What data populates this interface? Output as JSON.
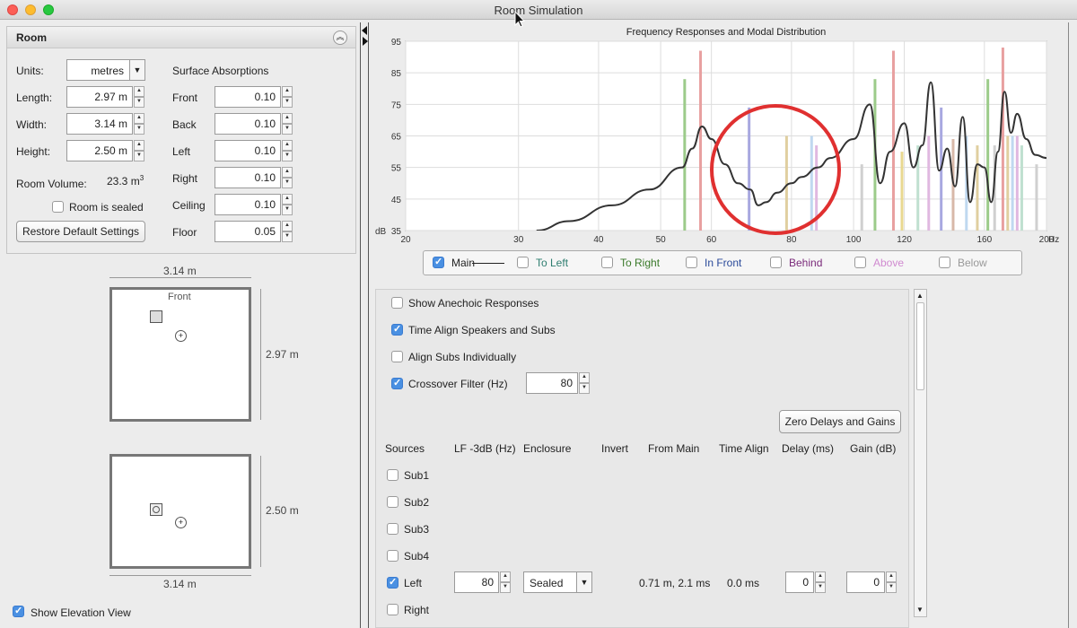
{
  "window": {
    "title": "Room Simulation"
  },
  "room": {
    "panel_title": "Room",
    "units_label": "Units:",
    "units_value": "metres",
    "length_label": "Length:",
    "length_value": "2.97 m",
    "width_label": "Width:",
    "width_value": "3.14 m",
    "height_label": "Height:",
    "height_value": "2.50 m",
    "volume_label": "Room Volume:",
    "volume_value": "23.3 m",
    "volume_exp": "3",
    "sealed_label": "Room is sealed",
    "sealed_checked": false,
    "restore_label": "Restore Default Settings",
    "surface_title": "Surface Absorptions",
    "surfaces": [
      {
        "label": "Front",
        "value": "0.10"
      },
      {
        "label": "Back",
        "value": "0.10"
      },
      {
        "label": "Left",
        "value": "0.10"
      },
      {
        "label": "Right",
        "value": "0.10"
      },
      {
        "label": "Ceiling",
        "value": "0.10"
      },
      {
        "label": "Floor",
        "value": "0.05"
      }
    ]
  },
  "plan": {
    "top_dim": "3.14 m",
    "front_label": "Front",
    "side_dim": "2.97 m",
    "elev_side_dim": "2.50 m",
    "elev_bottom_dim": "3.14 m",
    "show_elevation_label": "Show Elevation View",
    "show_elevation_checked": true
  },
  "chart_data": {
    "type": "line",
    "title": "Frequency Responses and Modal Distribution",
    "ylabel": "dB",
    "xunit": "Hz",
    "xscale": "log",
    "xlim": [
      20,
      200
    ],
    "ylim": [
      35,
      95
    ],
    "x_ticks": [
      20,
      30,
      40,
      50,
      60,
      80,
      100,
      120,
      160,
      200
    ],
    "y_ticks": [
      35,
      45,
      55,
      65,
      75,
      85,
      95
    ],
    "series": [
      {
        "name": "Main",
        "color": "#333333",
        "x": [
          32,
          36,
          42,
          48,
          54,
          56,
          58,
          60,
          63,
          66,
          69,
          71,
          73,
          76,
          80,
          83,
          88,
          92,
          100,
          106,
          110,
          114,
          120,
          124,
          128,
          132,
          136,
          140,
          144,
          148,
          152,
          156,
          160,
          164,
          168,
          172,
          176,
          180,
          186,
          192,
          200
        ],
        "y": [
          35,
          38,
          43,
          48,
          55,
          61,
          68,
          64,
          56,
          50,
          48,
          43,
          44,
          47,
          50,
          52,
          55,
          58,
          64,
          75,
          50,
          60,
          69,
          55,
          62,
          82,
          54,
          61,
          49,
          71,
          44,
          56,
          55,
          44,
          60,
          79,
          66,
          72,
          64,
          59,
          58
        ]
      }
    ],
    "modes": [
      {
        "f": 54.5,
        "h": 83,
        "color": "#9ccb8a"
      },
      {
        "f": 57.7,
        "h": 92,
        "color": "#e8a0a0"
      },
      {
        "f": 68.7,
        "h": 74,
        "color": "#a8a8e0"
      },
      {
        "f": 78.6,
        "h": 65,
        "color": "#e0cfa0"
      },
      {
        "f": 86,
        "h": 65,
        "color": "#c0d8f0"
      },
      {
        "f": 87.5,
        "h": 62,
        "color": "#e0b8e0"
      },
      {
        "f": 103,
        "h": 56,
        "color": "#d0d0d0"
      },
      {
        "f": 108,
        "h": 83,
        "color": "#9ccb8a"
      },
      {
        "f": 115.4,
        "h": 92,
        "color": "#e8a0a0"
      },
      {
        "f": 119,
        "h": 60,
        "color": "#e8d890"
      },
      {
        "f": 126,
        "h": 62,
        "color": "#c0e0d0"
      },
      {
        "f": 131,
        "h": 65,
        "color": "#e0b8e0"
      },
      {
        "f": 137,
        "h": 74,
        "color": "#a8a8e0"
      },
      {
        "f": 143,
        "h": 64,
        "color": "#d8b8a8"
      },
      {
        "f": 150,
        "h": 65,
        "color": "#c0d8f0"
      },
      {
        "f": 156,
        "h": 62,
        "color": "#e0cfa0"
      },
      {
        "f": 162,
        "h": 83,
        "color": "#9ccb8a"
      },
      {
        "f": 166,
        "h": 62,
        "color": "#d0d0d0"
      },
      {
        "f": 171,
        "h": 93,
        "color": "#e8a0a0"
      },
      {
        "f": 174,
        "h": 65,
        "color": "#e0cfa0"
      },
      {
        "f": 177,
        "h": 65,
        "color": "#c0d8f0"
      },
      {
        "f": 180,
        "h": 65,
        "color": "#e0b8e0"
      },
      {
        "f": 183,
        "h": 62,
        "color": "#c0e0d0"
      },
      {
        "f": 193,
        "h": 56,
        "color": "#d0d0d0"
      }
    ],
    "annotation_color": "#e03030",
    "legend": [
      {
        "label": "Main",
        "checked": true,
        "color": "#222222"
      },
      {
        "label": "To Left",
        "checked": false,
        "color": "#2e7d6f"
      },
      {
        "label": "To Right",
        "checked": false,
        "color": "#3a7a2a"
      },
      {
        "label": "In Front",
        "checked": false,
        "color": "#2a4a9a"
      },
      {
        "label": "Behind",
        "checked": false,
        "color": "#7a2a7a"
      },
      {
        "label": "Above",
        "checked": false,
        "color": "#d08ad0"
      },
      {
        "label": "Below",
        "checked": false,
        "color": "#999999"
      }
    ]
  },
  "settings": {
    "show_anechoic": {
      "label": "Show Anechoic Responses",
      "checked": false
    },
    "time_align": {
      "label": "Time Align Speakers and Subs",
      "checked": true
    },
    "align_subs": {
      "label": "Align Subs Individually",
      "checked": false
    },
    "crossover": {
      "label": "Crossover Filter (Hz)",
      "checked": true,
      "value": "80"
    },
    "zero_button": "Zero Delays and Gains",
    "columns": [
      "Sources",
      "LF -3dB (Hz)",
      "Enclosure",
      "Invert",
      "From Main",
      "Time Align",
      "Delay (ms)",
      "Gain (dB)"
    ],
    "sources": [
      {
        "name": "Sub1",
        "checked": false
      },
      {
        "name": "Sub2",
        "checked": false
      },
      {
        "name": "Sub3",
        "checked": false
      },
      {
        "name": "Sub4",
        "checked": false
      },
      {
        "name": "Left",
        "checked": true,
        "lf": "80",
        "enclosure": "Sealed",
        "from_main": "0.71 m, 2.1 ms",
        "time_align": "0.0 ms",
        "delay": "0",
        "gain": "0"
      },
      {
        "name": "Right",
        "checked": false
      }
    ]
  }
}
